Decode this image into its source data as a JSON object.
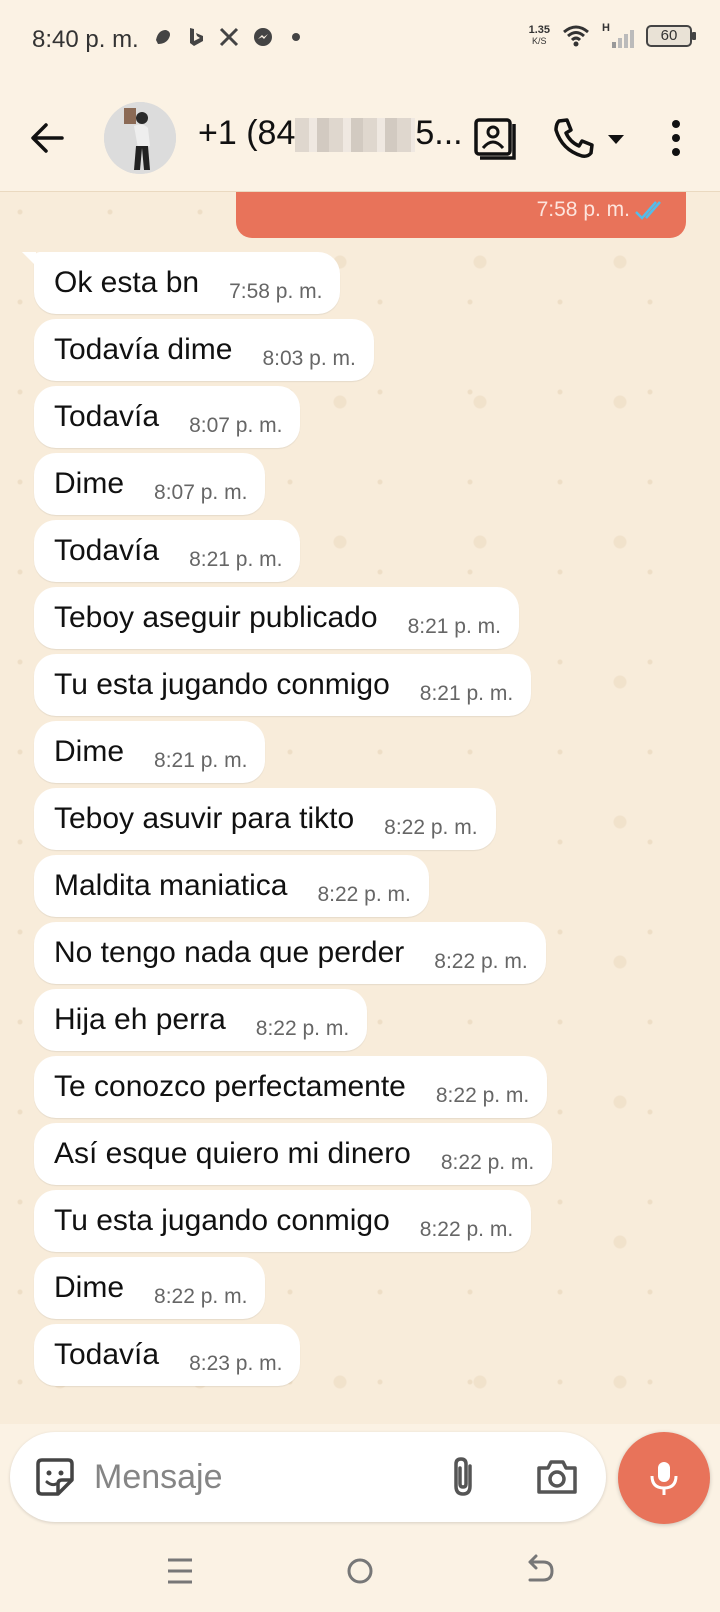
{
  "status_bar": {
    "time": "8:40 p. m.",
    "speed_value": "1.35",
    "speed_unit": "K/S",
    "network": "H",
    "battery": "60"
  },
  "header": {
    "contact_prefix": "+1 (84",
    "contact_suffix": "5..."
  },
  "chat": {
    "outgoing_time": "7:58 p. m.",
    "messages": [
      {
        "text": "Ok esta bn",
        "time": "7:58 p. m."
      },
      {
        "text": "Todavía dime",
        "time": "8:03 p. m."
      },
      {
        "text": "Todavía",
        "time": "8:07 p. m."
      },
      {
        "text": "Dime",
        "time": "8:07 p. m."
      },
      {
        "text": "Todavía",
        "time": "8:21 p. m."
      },
      {
        "text": "Teboy aseguir publicado",
        "time": "8:21 p. m."
      },
      {
        "text": "Tu esta jugando conmigo",
        "time": "8:21 p. m."
      },
      {
        "text": "Dime",
        "time": "8:21 p. m."
      },
      {
        "text": "Teboy asuvir para tikto",
        "time": "8:22 p. m."
      },
      {
        "text": "Maldita maniatica",
        "time": "8:22 p. m."
      },
      {
        "text": "No tengo nada que perder",
        "time": "8:22 p. m."
      },
      {
        "text": "Hija eh perra",
        "time": "8:22 p. m."
      },
      {
        "text": "Te conozco perfectamente",
        "time": "8:22 p. m."
      },
      {
        "text": "Así esque quiero mi dinero",
        "time": "8:22 p. m."
      },
      {
        "text": "Tu esta jugando conmigo",
        "time": "8:22 p. m."
      },
      {
        "text": "Dime",
        "time": "8:22 p. m."
      },
      {
        "text": "Todavía",
        "time": "8:23 p. m."
      }
    ]
  },
  "composer": {
    "placeholder": "Mensaje"
  },
  "colors": {
    "accent": "#e8735a",
    "background": "#fbf2e4",
    "bubble": "#ffffff",
    "read_ticks": "#53bdeb"
  },
  "icons": {
    "back": "arrow-left-icon",
    "contact_card": "contact-card-icon",
    "call": "phone-icon",
    "menu": "more-vertical-icon",
    "sticker": "sticker-icon",
    "attach": "paperclip-icon",
    "camera": "camera-icon",
    "mic": "microphone-icon",
    "scroll": "double-chevron-down-icon"
  }
}
